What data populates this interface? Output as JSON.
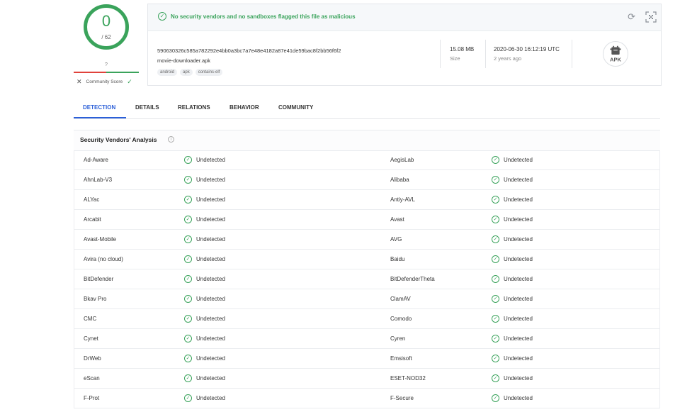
{
  "score": {
    "detections": "0",
    "total": "/ 62",
    "community_value": "?",
    "community_label": "Community Score",
    "reject_icon": "x-icon",
    "accept_icon": "check-icon",
    "colors": {
      "clean": "#3aa35b",
      "malicious": "#e0423b"
    }
  },
  "header": {
    "banner_text": "No security vendors and no sandboxes flagged this file as malicious",
    "banner_icon": "check-circle-icon",
    "hash": "590630326c585a782292e4bb0a3bc7a7e48e4182a87e41de59bac8f2bb56f6f2",
    "filename": "movie-downloader.apk",
    "tags": [
      "android",
      "apk",
      "contains-elf"
    ],
    "size_value": "15.08 MB",
    "size_label": "Size",
    "date_value": "2020-06-30 16:12:19 UTC",
    "date_label": "2 years ago",
    "file_type": "APK",
    "actions": [
      "refresh-icon",
      "qr-code-icon"
    ]
  },
  "tabs": [
    {
      "label": "DETECTION",
      "active": true
    },
    {
      "label": "DETAILS",
      "active": false
    },
    {
      "label": "RELATIONS",
      "active": false
    },
    {
      "label": "BEHAVIOR",
      "active": false
    },
    {
      "label": "COMMUNITY",
      "active": false
    }
  ],
  "analysis": {
    "title": "Security Vendors' Analysis",
    "rows": [
      {
        "left": {
          "vendor": "Ad-Aware",
          "result": "Undetected"
        },
        "right": {
          "vendor": "AegisLab",
          "result": "Undetected"
        }
      },
      {
        "left": {
          "vendor": "AhnLab-V3",
          "result": "Undetected"
        },
        "right": {
          "vendor": "Alibaba",
          "result": "Undetected"
        }
      },
      {
        "left": {
          "vendor": "ALYac",
          "result": "Undetected"
        },
        "right": {
          "vendor": "Antiy-AVL",
          "result": "Undetected"
        }
      },
      {
        "left": {
          "vendor": "Arcabit",
          "result": "Undetected"
        },
        "right": {
          "vendor": "Avast",
          "result": "Undetected"
        }
      },
      {
        "left": {
          "vendor": "Avast-Mobile",
          "result": "Undetected"
        },
        "right": {
          "vendor": "AVG",
          "result": "Undetected"
        }
      },
      {
        "left": {
          "vendor": "Avira (no cloud)",
          "result": "Undetected"
        },
        "right": {
          "vendor": "Baidu",
          "result": "Undetected"
        }
      },
      {
        "left": {
          "vendor": "BitDefender",
          "result": "Undetected"
        },
        "right": {
          "vendor": "BitDefenderTheta",
          "result": "Undetected"
        }
      },
      {
        "left": {
          "vendor": "Bkav Pro",
          "result": "Undetected"
        },
        "right": {
          "vendor": "ClamAV",
          "result": "Undetected"
        }
      },
      {
        "left": {
          "vendor": "CMC",
          "result": "Undetected"
        },
        "right": {
          "vendor": "Comodo",
          "result": "Undetected"
        }
      },
      {
        "left": {
          "vendor": "Cynet",
          "result": "Undetected"
        },
        "right": {
          "vendor": "Cyren",
          "result": "Undetected"
        }
      },
      {
        "left": {
          "vendor": "DrWeb",
          "result": "Undetected"
        },
        "right": {
          "vendor": "Emsisoft",
          "result": "Undetected"
        }
      },
      {
        "left": {
          "vendor": "eScan",
          "result": "Undetected"
        },
        "right": {
          "vendor": "ESET-NOD32",
          "result": "Undetected"
        }
      },
      {
        "left": {
          "vendor": "F-Prot",
          "result": "Undetected"
        },
        "right": {
          "vendor": "F-Secure",
          "result": "Undetected"
        }
      }
    ]
  }
}
